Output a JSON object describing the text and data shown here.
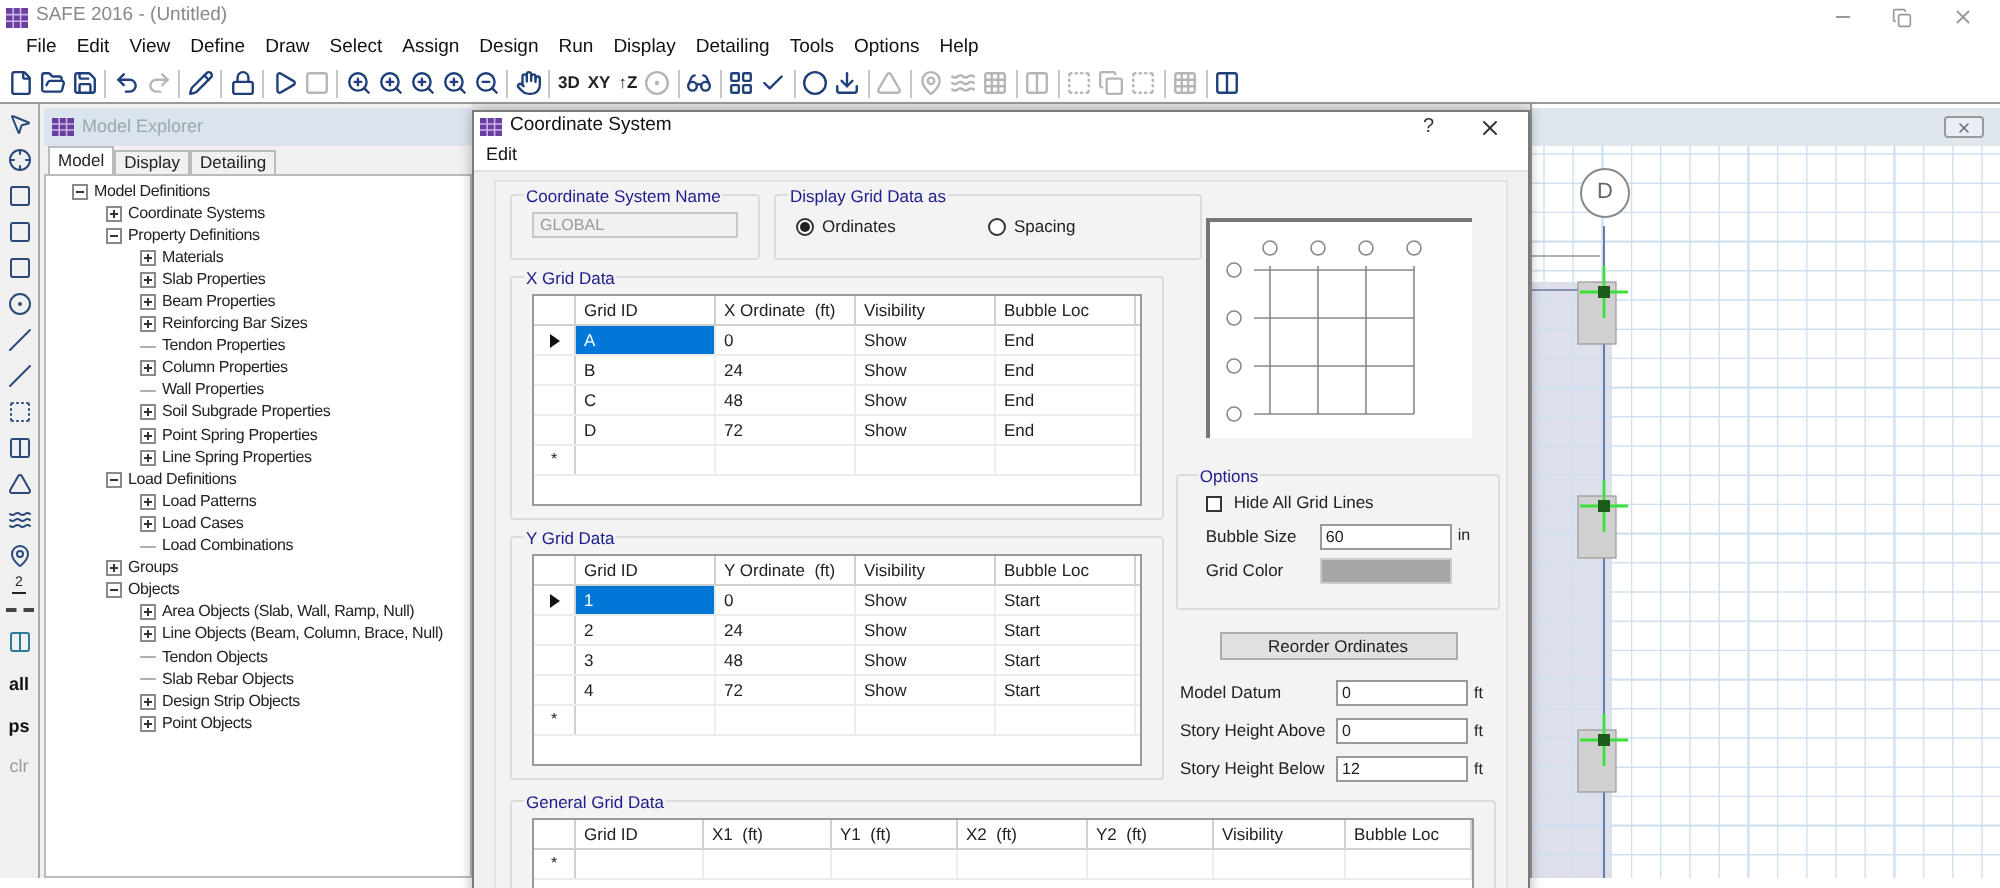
{
  "app": {
    "title": "SAFE 2016 - (Untitled)"
  },
  "menu": [
    "File",
    "Edit",
    "View",
    "Define",
    "Draw",
    "Select",
    "Assign",
    "Design",
    "Run",
    "Display",
    "Detailing",
    "Tools",
    "Options",
    "Help"
  ],
  "toolbar": {
    "view_buttons": [
      "3D",
      "XY",
      "↑Z"
    ]
  },
  "side_toolbar": {
    "dimension_label": "2",
    "text_buttons": [
      {
        "label": "all",
        "disabled": false
      },
      {
        "label": "ps",
        "disabled": false
      },
      {
        "label": "clr",
        "disabled": true
      }
    ]
  },
  "model_explorer": {
    "title": "Model Explorer",
    "tabs": [
      {
        "label": "Model",
        "selected": true
      },
      {
        "label": "Display",
        "selected": false
      },
      {
        "label": "Detailing",
        "selected": false
      }
    ],
    "tree": [
      {
        "label": "Model Definitions",
        "kind": "branch",
        "expanded": true,
        "children": [
          {
            "label": "Coordinate Systems",
            "kind": "branch",
            "expanded": false
          },
          {
            "label": "Property Definitions",
            "kind": "branch",
            "expanded": true,
            "children": [
              {
                "label": "Materials",
                "kind": "branch",
                "expanded": false
              },
              {
                "label": "Slab Properties",
                "kind": "branch",
                "expanded": false
              },
              {
                "label": "Beam Properties",
                "kind": "branch",
                "expanded": false
              },
              {
                "label": "Reinforcing Bar Sizes",
                "kind": "branch",
                "expanded": false
              },
              {
                "label": "Tendon Properties",
                "kind": "leaf"
              },
              {
                "label": "Column Properties",
                "kind": "branch",
                "expanded": false
              },
              {
                "label": "Wall Properties",
                "kind": "leaf"
              },
              {
                "label": "Soil Subgrade Properties",
                "kind": "branch",
                "expanded": false
              },
              {
                "label": "Point Spring Properties",
                "kind": "branch",
                "expanded": false
              },
              {
                "label": "Line Spring Properties",
                "kind": "branch",
                "expanded": false
              }
            ]
          },
          {
            "label": "Load Definitions",
            "kind": "branch",
            "expanded": true,
            "children": [
              {
                "label": "Load Patterns",
                "kind": "branch",
                "expanded": false
              },
              {
                "label": "Load Cases",
                "kind": "branch",
                "expanded": false
              },
              {
                "label": "Load Combinations",
                "kind": "leaf"
              }
            ]
          },
          {
            "label": "Groups",
            "kind": "branch",
            "expanded": false
          },
          {
            "label": "Objects",
            "kind": "branch",
            "expanded": true,
            "children": [
              {
                "label": "Area Objects (Slab, Wall, Ramp, Null)",
                "kind": "branch",
                "expanded": false
              },
              {
                "label": "Line Objects (Beam, Column, Brace, Null)",
                "kind": "branch",
                "expanded": false
              },
              {
                "label": "Tendon Objects",
                "kind": "leaf"
              },
              {
                "label": "Slab Rebar Objects",
                "kind": "leaf"
              },
              {
                "label": "Design Strip Objects",
                "kind": "branch",
                "expanded": false
              },
              {
                "label": "Point Objects",
                "kind": "branch",
                "expanded": false
              }
            ]
          }
        ]
      }
    ]
  },
  "dialog": {
    "title": "Coordinate System",
    "help": "?",
    "menu": [
      "Edit"
    ],
    "name_group": {
      "title": "Coordinate System Name",
      "value": "GLOBAL",
      "disabled": true
    },
    "display_group": {
      "title": "Display Grid Data as",
      "options": [
        {
          "label": "Ordinates",
          "selected": true
        },
        {
          "label": "Spacing",
          "selected": false
        }
      ]
    },
    "x_grid": {
      "title": "X Grid Data",
      "new_row_marker": "*",
      "columns": [
        "Grid ID",
        "X Ordinate  (ft)",
        "Visibility",
        "Bubble Loc"
      ],
      "rows": [
        {
          "selected": true,
          "cells": [
            "A",
            "0",
            "Show",
            "End"
          ]
        },
        {
          "selected": false,
          "cells": [
            "B",
            "24",
            "Show",
            "End"
          ]
        },
        {
          "selected": false,
          "cells": [
            "C",
            "48",
            "Show",
            "End"
          ]
        },
        {
          "selected": false,
          "cells": [
            "D",
            "72",
            "Show",
            "End"
          ]
        }
      ]
    },
    "y_grid": {
      "title": "Y Grid Data",
      "new_row_marker": "*",
      "columns": [
        "Grid ID",
        "Y Ordinate  (ft)",
        "Visibility",
        "Bubble Loc"
      ],
      "rows": [
        {
          "selected": true,
          "cells": [
            "1",
            "0",
            "Show",
            "Start"
          ]
        },
        {
          "selected": false,
          "cells": [
            "2",
            "24",
            "Show",
            "Start"
          ]
        },
        {
          "selected": false,
          "cells": [
            "3",
            "48",
            "Show",
            "Start"
          ]
        },
        {
          "selected": false,
          "cells": [
            "4",
            "72",
            "Show",
            "Start"
          ]
        }
      ]
    },
    "options": {
      "title": "Options",
      "hide_grid_lines": {
        "label": "Hide All Grid Lines",
        "checked": false
      },
      "bubble_size": {
        "label": "Bubble Size",
        "value": "60",
        "unit": "in"
      },
      "grid_color": {
        "label": "Grid Color",
        "color": "#a6a6a6"
      }
    },
    "reorder_button": "Reorder Ordinates",
    "fields": [
      {
        "label": "Model Datum",
        "value": "0",
        "unit": "ft"
      },
      {
        "label": "Story Height Above",
        "value": "0",
        "unit": "ft"
      },
      {
        "label": "Story Height Below",
        "value": "12",
        "unit": "ft"
      }
    ],
    "general_grid": {
      "title": "General Grid Data",
      "new_row_marker": "*",
      "columns": [
        "Grid ID",
        "X1  (ft)",
        "Y1  (ft)",
        "X2  (ft)",
        "Y2  (ft)",
        "Visibility",
        "Bubble Loc"
      ]
    }
  },
  "canvas": {
    "bubble": "D"
  }
}
